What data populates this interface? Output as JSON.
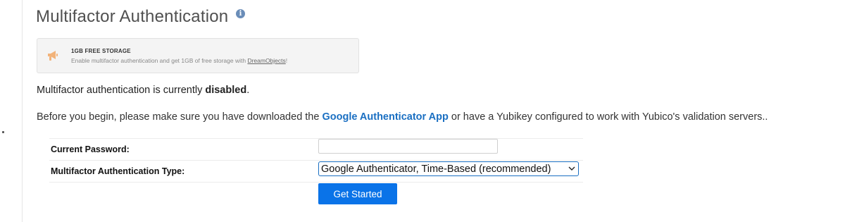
{
  "header": {
    "title": "Multifactor Authentication",
    "info_icon": "info-icon",
    "info_glyph": "i"
  },
  "promo": {
    "icon": "megaphone-icon",
    "title": "1GB FREE STORAGE",
    "text_before": "Enable multifactor authentication and get 1GB of free storage with ",
    "link_text": "DreamObjects",
    "text_after": "!"
  },
  "status": {
    "prefix": "Multifactor authentication is currently ",
    "state": "disabled",
    "suffix": "."
  },
  "intro": {
    "before": "Before you begin, please make sure you have downloaded the ",
    "link_text": "Google Authenticator App",
    "after": " or have a Yubikey configured to work with Yubico's validation servers.."
  },
  "form": {
    "password_label": "Current Password:",
    "password_value": "",
    "password_placeholder": "",
    "type_label": "Multifactor Authentication Type:",
    "type_selected": "Google Authenticator, Time-Based (recommended)",
    "submit_label": "Get Started"
  },
  "colors": {
    "link": "#1a6fc2",
    "button": "#0a73e8",
    "promo_icon": "#f2b37a"
  }
}
